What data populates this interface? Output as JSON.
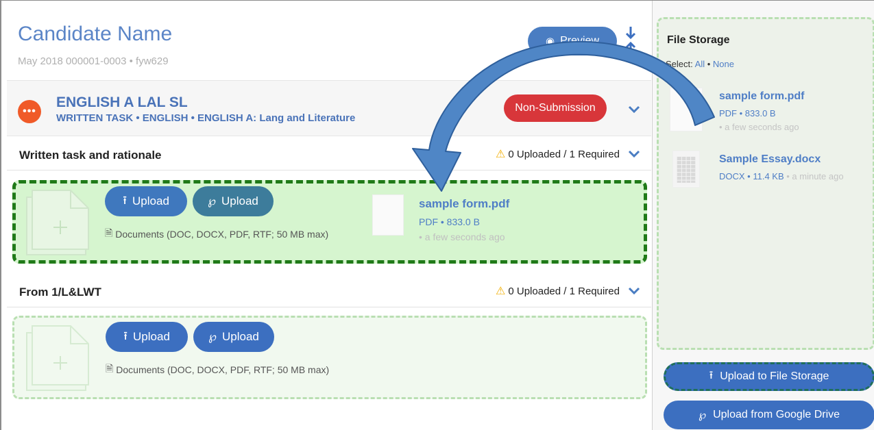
{
  "candidate": {
    "name": "Candidate Name",
    "subtitle": "May 2018 000001-0003 • fyw629",
    "preview_label": "Preview"
  },
  "subject": {
    "title": "ENGLISH A LAL SL",
    "subtitle": "WRITTEN TASK • ENGLISH • ENGLISH A: Lang and Literature",
    "status_label": "Non-Submission",
    "status_color": "#d8363a"
  },
  "sections": [
    {
      "title": "Written task and rationale",
      "status": "0 Uploaded / 1 Required",
      "upload_label": "Upload",
      "drive_upload_label": "Upload",
      "doc_types": "Documents (DOC, DOCX, PDF, RTF; 50 MB max)",
      "dropped_file": {
        "name": "sample form.pdf",
        "meta": "PDF • 833.0 B",
        "time": "• a few seconds ago"
      }
    },
    {
      "title": "From 1/L&LWT",
      "status": "0 Uploaded / 1 Required",
      "upload_label": "Upload",
      "drive_upload_label": "Upload",
      "doc_types": "Documents (DOC, DOCX, PDF, RTF; 50 MB max)"
    }
  ],
  "storage": {
    "title": "File Storage",
    "select_label": "Select:",
    "select_all": "All",
    "select_sep": " • ",
    "select_none": "None",
    "files": [
      {
        "name": "sample form.pdf",
        "meta": "PDF • 833.0 B",
        "time": "• a few seconds ago"
      },
      {
        "name": "Sample Essay.docx",
        "meta": "DOCX • 11.4 KB",
        "time": "• a minute ago"
      }
    ],
    "upload_to_storage_label": "Upload to File Storage",
    "upload_from_drive_label": "Upload from Google Drive"
  },
  "icons": {
    "preview": "eye-icon",
    "collapse": "collapse-arrows-icon",
    "menu": "more-dots-icon",
    "warning": "warning-triangle-icon",
    "upload": "upload-icon",
    "google_drive": "google-drive-icon",
    "document": "document-icon",
    "chevron": "chevron-down-icon",
    "drag_arrow": "curved-arrow-icon"
  },
  "colors": {
    "accent": "#4a7dc2",
    "dropzone_active_border": "#1f7a18",
    "dropzone_idle_border": "#b9dfb2",
    "arrow_fill": "#4f86c6"
  }
}
